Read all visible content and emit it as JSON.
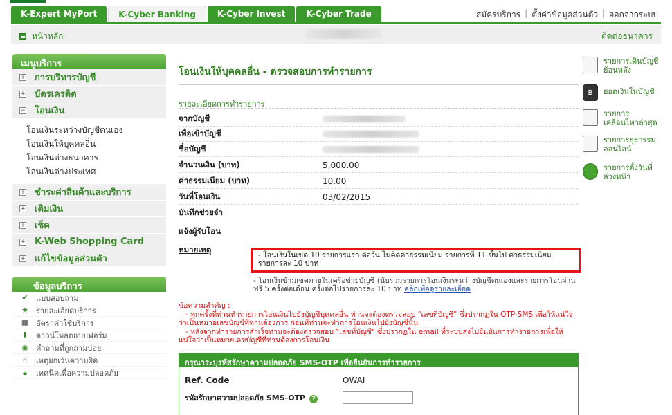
{
  "tabs": [
    "K-Expert MyPort",
    "K-Cyber Banking",
    "K-Cyber Invest",
    "K-Cyber Trade"
  ],
  "active_tab": "K-Cyber Banking",
  "top_links": [
    "สมัครบริการ",
    "ตั้งค่าข้อมูลส่วนตัว",
    "ออกจากระบบ"
  ],
  "homebar": {
    "home": "หน้าหลัก",
    "contact": "ติดต่อธนาคาร"
  },
  "sidebar": {
    "heading": "เมนูบริการ",
    "items": [
      {
        "label": "การบริหารบัญชี",
        "toggle": "+"
      },
      {
        "label": "บัตรเครดิต",
        "toggle": "+"
      },
      {
        "label": "โอนเงิน",
        "toggle": "−"
      }
    ],
    "sub_items": [
      "โอนเงินระหว่างบัญชีตนเอง",
      "โอนเงินให้บุคคลอื่น",
      "โอนเงินต่างธนาคาร",
      "โอนเงินต่างประเทศ"
    ],
    "items_after": [
      {
        "label": "ชำระค่าสินค้าและบริการ",
        "toggle": "+"
      },
      {
        "label": "เติมเงิน",
        "toggle": "+"
      },
      {
        "label": "เช็ค",
        "toggle": "+"
      },
      {
        "label": "K-Web Shopping Card",
        "toggle": "+"
      },
      {
        "label": "แก้ไขข้อมูลส่วนตัว",
        "toggle": "+"
      }
    ]
  },
  "info": {
    "heading": "ข้อมูลบริการ",
    "items": [
      {
        "label": "แบบสอบถาม",
        "icon": "check-icon"
      },
      {
        "label": "รายละเอียดบริการ",
        "icon": "star-icon"
      },
      {
        "label": "อัตราค่าใช้บริการ",
        "icon": "calculator-icon"
      },
      {
        "label": "ดาวน์โหลดแบบฟอร์ม",
        "icon": "download-icon"
      },
      {
        "label": "คำถามที่ถูกถามบ่อย",
        "icon": "faq-icon"
      },
      {
        "label": "เหตุยกเว้นความผิด",
        "icon": "hand-icon"
      },
      {
        "label": "เทคนิคเพื่อความปลอดภัย",
        "icon": "lock-icon"
      }
    ]
  },
  "main": {
    "title": "โอนเงินให้บุคคลอื่น - ตรวจสอบการทำรายการ",
    "section_title": "รายละเอียดการทำรายการ",
    "fields": [
      {
        "label": "จากบัญชี",
        "value": ""
      },
      {
        "label": "เพื่อเข้าบัญชี",
        "value": ""
      },
      {
        "label": "ชื่อบัญชี",
        "value": ""
      },
      {
        "label": "จำนวนเงิน (บาท)",
        "value": "5,000.00"
      },
      {
        "label": "ค่าธรรมเนียม (บาท)",
        "value": "10.00"
      },
      {
        "label": "วันที่โอนเงิน",
        "value": "03/02/2015"
      },
      {
        "label": "บันทึกช่วยจำ",
        "value": ""
      },
      {
        "label": "แจ้งผู้รับโอน",
        "value": ""
      }
    ],
    "note_label": "หมายเหตุ",
    "note_boxed": "- โอนเงินในเขต 10 รายการแรก ต่อวัน ไม่คิดค่าธรรมเนียม รายการที่ 11 ขึ้นไป ค่าธรรมเนียมรายการละ 10 บาท",
    "note_partial": "- โอนเงินข้ามเขตภายในเครือข่ายบัญชี (นับรวมรายการโอนเงินระหว่างบัญชีตนเองและรายการโอนผ่านมือถือ)",
    "note_free": "ฟรี 5 ครั้งต่อเดือน ครั้งต่อไปรายการละ 10 บาท",
    "note_link": "คลิกเพื่อดูรายละเอียด",
    "important_title": "ข้อความสำคัญ :",
    "important_1": "- ทุกครั้งที่ท่านทำรายการโอนเงินไปยังบัญชีบุคคลอื่น ท่านจะต้องตรวจสอบ \"เลขที่บัญชี\" ซึ่งปรากฏใน OTP-SMS เพื่อให้แน่ใจว่าเป็นหมายเลขบัญชีที่ท่านต้องการ ก่อนที่ท่านจะทำการโอนเงินไปยังบัญชีนั้น",
    "important_2": "- หลังจากทำรายการสำเร็จท่านจะต้องตรวจสอบ \"เลขที่บัญชี\" ซึ่งปรากฏใน email ที่ระบบส่งไปยืนยันการทำรายการเพื่อให้แน่ใจว่าเป็นหมายเลขบัญชีที่ท่านต้องการโอนเงิน"
  },
  "otp": {
    "heading": "กรุณาระบุรหัสรักษาความปลอดภัย SMS-OTP เพื่อยืนยันการทำรายการ",
    "ref_label": "Ref. Code",
    "ref_value": "OWAI",
    "code_label": "รหัสรักษาความปลอดภัย SMS-OTP",
    "help_icon": "?"
  },
  "quick_links": [
    {
      "label": "รายการเดินบัญชีย้อนหลัง",
      "icon": "statement-icon"
    },
    {
      "label": "ยอดเงินในบัญชี",
      "icon": "balance-icon",
      "badge": "฿"
    },
    {
      "label": "รายการเคลื่อนไหวล่าสุด",
      "icon": "recent-icon"
    },
    {
      "label": "รายการธุรกรรมออนไลน์",
      "icon": "online-icon"
    },
    {
      "label": "รายการตั้งวันที่ล่วงหน้า",
      "icon": "clock-icon"
    }
  ]
}
